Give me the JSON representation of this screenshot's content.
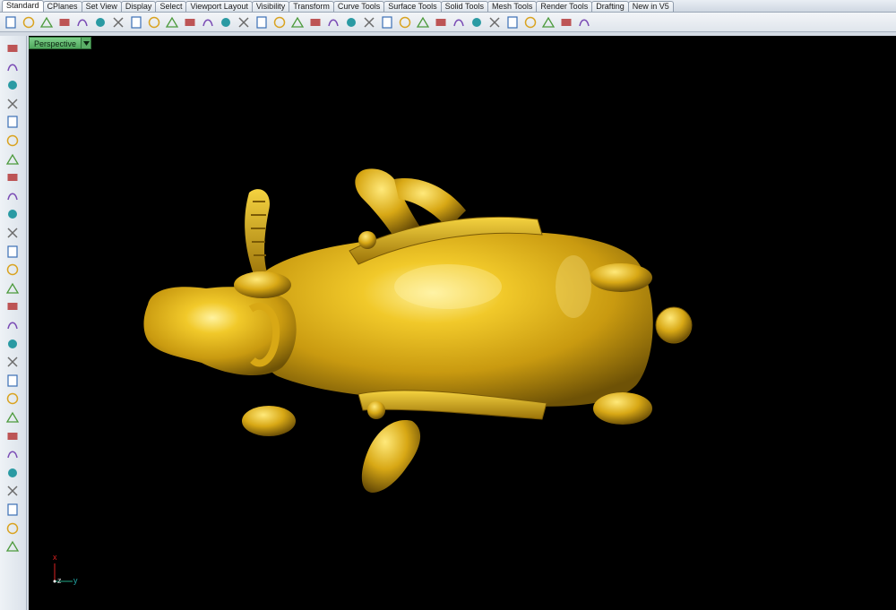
{
  "tabs": [
    "Standard",
    "CPlanes",
    "Set View",
    "Display",
    "Select",
    "Viewport Layout",
    "Visibility",
    "Transform",
    "Curve Tools",
    "Surface Tools",
    "Solid Tools",
    "Mesh Tools",
    "Render Tools",
    "Drafting",
    "New in V5"
  ],
  "viewport": {
    "title": "Perspective"
  },
  "axes": {
    "x": "x",
    "y": "y",
    "z": "z"
  },
  "colors": {
    "model": "#e0b21c",
    "viewport_bg": "#000000",
    "viewport_tab": "#5aae66"
  },
  "toolbar_icons": [
    "new-icon",
    "open-icon",
    "save-icon",
    "print-icon",
    "import-icon",
    "cut-icon",
    "copy-icon",
    "paste-icon",
    "undo-icon",
    "pan-icon",
    "move-icon",
    "zoom-icon",
    "zoom-window-icon",
    "zoom-extents-icon",
    "zoom-selected-icon",
    "rotate-view-icon",
    "four-viewports-icon",
    "select-curves-icon",
    "car-icon",
    "points-icon",
    "edit-points-icon",
    "lock-icon",
    "light-icon",
    "lock-layer-icon",
    "render-icon",
    "color-wheel-icon",
    "sphere-icon",
    "mesh-icon",
    "render-preview-icon",
    "environment-icon",
    "dimension-icon",
    "properties-icon",
    "help-icon"
  ],
  "left_icons": [
    "select-arrow-icon",
    "point-icon",
    "polyline-icon",
    "curve-icon",
    "circle-icon",
    "ellipse-icon",
    "polygon-icon",
    "rectangle-icon",
    "arc-icon",
    "offset-icon",
    "surface-icon",
    "extrude-icon",
    "box-solid-icon",
    "boolean-icon",
    "cylinder-icon",
    "mesh-tool-icon",
    "gear-icon",
    "transform-icon",
    "dimension-tool-icon",
    "analyze-icon",
    "blend-icon",
    "fillet-icon",
    "text-icon",
    "group-icon",
    "block-icon",
    "layer-icon",
    "render-mesh-icon",
    "more-icon"
  ]
}
